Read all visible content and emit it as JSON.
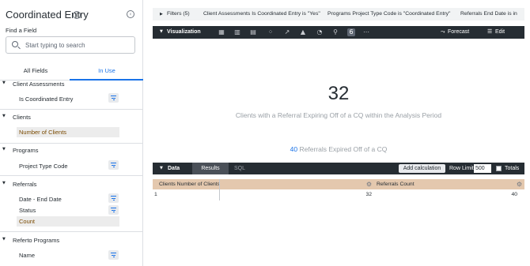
{
  "sidebar": {
    "title": "Coordinated Entry",
    "info_glyph": "i",
    "collapse_glyph": "‹",
    "find_label": "Find a Field",
    "search_placeholder": "Start typing to search",
    "tabs": [
      {
        "label": "All Fields",
        "active": false
      },
      {
        "label": "In Use",
        "active": true
      }
    ],
    "groups": [
      {
        "label": "Client Assessments",
        "fields": [
          {
            "label": "Is Coordinated Entry",
            "filtered": true,
            "highlighted": false
          }
        ]
      },
      {
        "label": "Clients",
        "fields": [
          {
            "label": "Number of Clients",
            "filtered": false,
            "highlighted": true
          }
        ]
      },
      {
        "label": "Programs",
        "fields": [
          {
            "label": "Project Type Code",
            "filtered": true,
            "highlighted": false
          }
        ]
      },
      {
        "label": "Referrals",
        "fields": [
          {
            "label": "Date - End Date",
            "filtered": true,
            "highlighted": false
          },
          {
            "label": "Status",
            "filtered": true,
            "highlighted": false
          },
          {
            "label": "Count",
            "filtered": false,
            "highlighted": true
          }
        ]
      },
      {
        "label": "Referto Programs",
        "fields": [
          {
            "label": "Name",
            "filtered": true,
            "highlighted": false
          }
        ]
      }
    ]
  },
  "filters_bar": {
    "label": "Filters (5)",
    "items": [
      "Client Assessments Is Coordinated Entry is \"Yes\"",
      "Programs Project Type Code is \"Coordinated Entry\"",
      "Referrals End Date is in"
    ]
  },
  "visualization_bar": {
    "label": "Visualization",
    "icons": [
      "table-icon",
      "bar-chart-icon",
      "column-chart-icon",
      "scatter-icon",
      "line-chart-icon",
      "area-chart-icon",
      "pie-chart-icon",
      "map-pin-icon",
      "single-value-icon",
      "more-icon"
    ],
    "selected_icon": "single-value-icon",
    "forecast_label": "Forecast",
    "edit_label": "Edit"
  },
  "single_value": {
    "value": "32",
    "caption": "Clients with a Referral Expiring Off of a CQ within the Analysis Period",
    "comparison_value": "40",
    "comparison_text": "Referrals Expired Off of a CQ"
  },
  "data_bar": {
    "label": "Data",
    "tabs": [
      "Results",
      "SQL"
    ],
    "active_tab": "Results",
    "add_calc_label": "Add calculation",
    "row_limit_label": "Row Limit",
    "row_limit_value": "500",
    "totals_label": "Totals",
    "totals_checked": false
  },
  "table": {
    "columns": [
      "Clients Number of Clients",
      "Referrals Count"
    ],
    "rows": [
      {
        "index": "1",
        "cells": [
          "32",
          "40"
        ]
      }
    ]
  },
  "colors": {
    "accent": "#1a73e8",
    "dark_bar": "#262d33",
    "table_header": "#e4c8ae",
    "highlight_field": "#ececec"
  }
}
